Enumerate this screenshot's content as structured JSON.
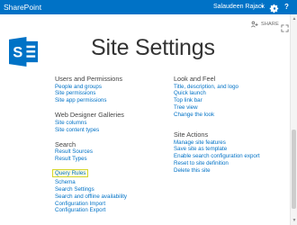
{
  "colors": {
    "suite_bar": "#0072c6",
    "link": "#0072c6",
    "highlight_border": "#d6d62a",
    "logo": "#0072c6"
  },
  "suite_bar": {
    "brand": "SharePoint",
    "user_name": "Salaudeen Rajack",
    "user_caret": "▾",
    "help": "?"
  },
  "toolbar": {
    "share_label": "SHARE"
  },
  "page": {
    "title": "Site Settings"
  },
  "left_column": {
    "users": {
      "heading": "Users and Permissions",
      "links": [
        "People and groups",
        "Site permissions",
        "Site app permissions"
      ]
    },
    "designer": {
      "heading": "Web Designer Galleries",
      "links": [
        "Site columns",
        "Site content types"
      ]
    },
    "search": {
      "heading": "Search",
      "links": [
        "Result Sources",
        "Result Types",
        "Query Rules",
        "Schema",
        "Search Settings",
        "Search and offline availability",
        "Configuration Import",
        "Configuration Export"
      ]
    }
  },
  "right_column": {
    "look": {
      "heading": "Look and Feel",
      "links": [
        "Title, description, and logo",
        "Quick launch",
        "Top link bar",
        "Tree view",
        "Change the look"
      ]
    },
    "actions": {
      "heading": "Site Actions",
      "links": [
        "Manage site features",
        "Save site as template",
        "Enable search configuration export",
        "Reset to site definition",
        "Delete this site"
      ]
    }
  },
  "icons": {
    "gear": "gear-icon",
    "help": "help-icon",
    "share": "share-icon",
    "focus": "focus-on-content-icon",
    "logo": "sharepoint-logo-icon"
  }
}
